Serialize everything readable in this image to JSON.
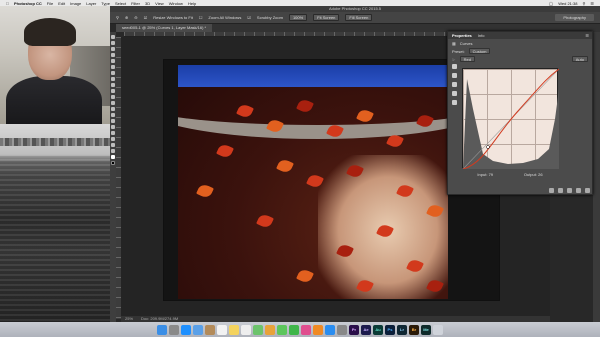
{
  "menubar": {
    "app_name": "Photoshop CC",
    "menus": [
      "File",
      "Edit",
      "Image",
      "Layer",
      "Type",
      "Select",
      "Filter",
      "3D",
      "View",
      "Window",
      "Help"
    ],
    "clock": "Wed 21:38"
  },
  "window": {
    "title": "Adobe Photoshop CC 2015.5",
    "workspace": "Photography"
  },
  "options_bar": {
    "resize_windows": "Resize Windows to Fit",
    "zoom_all": "Zoom All Windows",
    "scrubby_zoom": "Scrubby Zoom",
    "zoom_level": "100%",
    "fit_screen": "Fit Screen",
    "fill_screen": "Fill Screen"
  },
  "document": {
    "tab_label": "seed005-1 @ 25% (Curves 1, Layer Mask/16) *",
    "status_zoom": "25%",
    "status_doc": "Doc: 209.9M/274.9M"
  },
  "properties": {
    "tab_active": "Properties",
    "tab_other": "Info",
    "adjustment_name": "Curves",
    "preset_label": "Preset:",
    "preset_value": "Custom",
    "channel_value": "Red",
    "auto_label": "Auto",
    "input_label": "Input:",
    "input_value": "79",
    "output_label": "Output:",
    "output_value": "26"
  },
  "dock_apps": [
    "Finder",
    "Launchpad",
    "Safari",
    "Mail",
    "Contacts",
    "Calendar",
    "Notes",
    "Reminders",
    "Maps",
    "Photos",
    "Messages",
    "FaceTime",
    "iTunes",
    "iBooks",
    "App Store",
    "System Preferences",
    "Pr",
    "Ae",
    "Au",
    "Ps",
    "Lr",
    "Br",
    "Me",
    "Trash"
  ],
  "colors": {
    "ps_bg": "#282828",
    "panel_bg": "#4b4b4b",
    "curve_red": "#d23a1f"
  }
}
